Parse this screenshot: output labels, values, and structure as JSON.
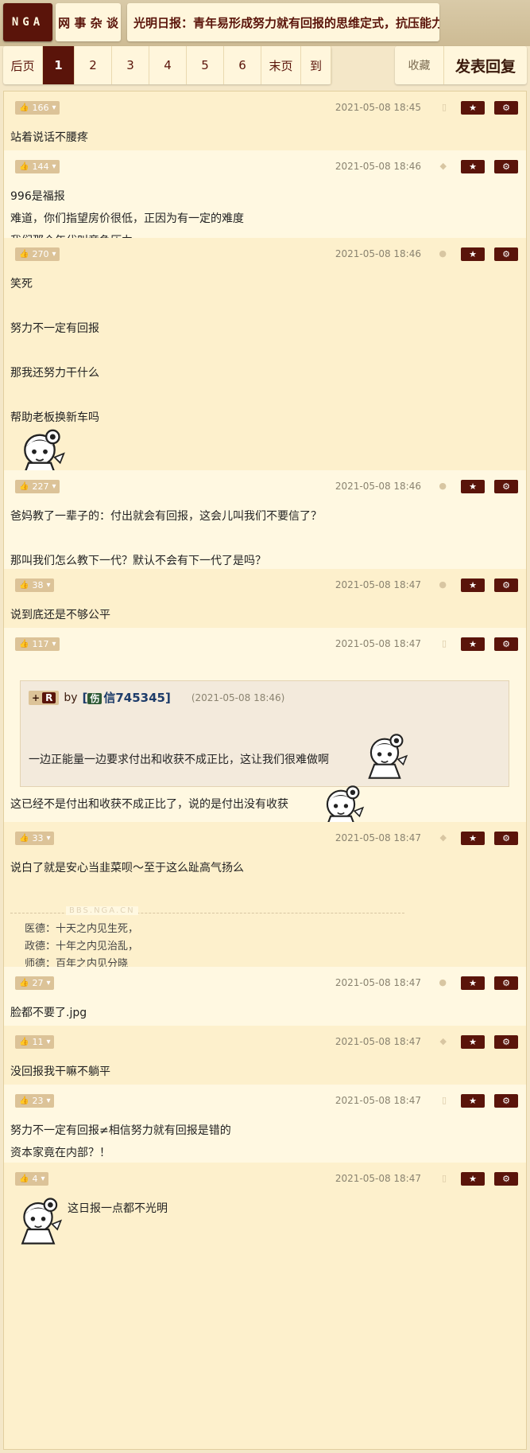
{
  "header": {
    "logo": "NGA",
    "forum": "网 事 杂 谈",
    "title": "光明日报：青年易形成努力就有回报的思维定式，抗压能力差"
  },
  "pager": {
    "items": [
      "后页",
      "1",
      "2",
      "3",
      "4",
      "5",
      "6",
      "末页",
      "到"
    ],
    "active": "1"
  },
  "actions": {
    "favorite": "收藏",
    "reply": "发表回复"
  },
  "colors": {
    "brand": "#5a140a",
    "bg": "#f4e7c8",
    "row_odd": "#fdf0cc",
    "row_even": "#fff8e1"
  },
  "posts": [
    {
      "votes": "166",
      "date": "2021-05-08 18:45",
      "device": "mobile-icon",
      "lines": [
        "站着说话不腰疼"
      ]
    },
    {
      "votes": "144",
      "date": "2021-05-08 18:46",
      "device": "android-icon",
      "lines": [
        "996是福报",
        "难道，你们指望房价很低，正因为有一定的难度",
        "我们那个年代叫竞争压力"
      ]
    },
    {
      "votes": "270",
      "date": "2021-05-08 18:46",
      "device": "apple-icon",
      "lines": [
        "笑死",
        "",
        "努力不一定有回报",
        "",
        "那我还努力干什么",
        "",
        "帮助老板换新车吗"
      ]
    },
    {
      "votes": "227",
      "date": "2021-05-08 18:46",
      "device": "apple-icon",
      "lines": [
        "爸妈教了一辈子的：付出就会有回报，这会儿叫我们不要信了？",
        "",
        "那叫我们怎么教下一代？默认不会有下一代了是吗？"
      ]
    },
    {
      "votes": "38",
      "date": "2021-05-08 18:47",
      "device": "apple-icon",
      "lines": [
        "说到底还是不够公平"
      ]
    },
    {
      "votes": "117",
      "date": "2021-05-08 18:47",
      "device": "mobile-icon",
      "quote": {
        "tag": "R",
        "by": "by",
        "user_badge": "伤",
        "user": "信745345",
        "date": "(2021-05-08 18:46)",
        "text": "一边正能量一边要求付出和收获不成正比，这让我们很难做啊"
      },
      "lines": [
        "这已经不是付出和收获不成正比了，说的是付出没有收获"
      ]
    },
    {
      "votes": "33",
      "date": "2021-05-08 18:47",
      "device": "android-icon",
      "lines": [
        "说白了就是安心当韭菜呗～至于这么趾高气扬么"
      ],
      "signature": {
        "mark": "BBS.NGA.CN",
        "lines": [
          "医德：十天之内见生死，",
          "政德：十年之内见治乱，",
          "师德：百年之内见分晓"
        ]
      }
    },
    {
      "votes": "27",
      "date": "2021-05-08 18:47",
      "device": "apple-icon",
      "lines": [
        "脸都不要了.jpg"
      ]
    },
    {
      "votes": "11",
      "date": "2021-05-08 18:47",
      "device": "android-icon",
      "lines": [
        "没回报我干嘛不躺平"
      ]
    },
    {
      "votes": "23",
      "date": "2021-05-08 18:47",
      "device": "mobile-icon",
      "lines": [
        "努力不一定有回报≠相信努力就有回报是错的",
        "资本家竟在内部？！"
      ]
    },
    {
      "votes": "4",
      "date": "2021-05-08 18:47",
      "device": "mobile-icon",
      "lines": [
        "这日报一点都不光明"
      ]
    }
  ]
}
